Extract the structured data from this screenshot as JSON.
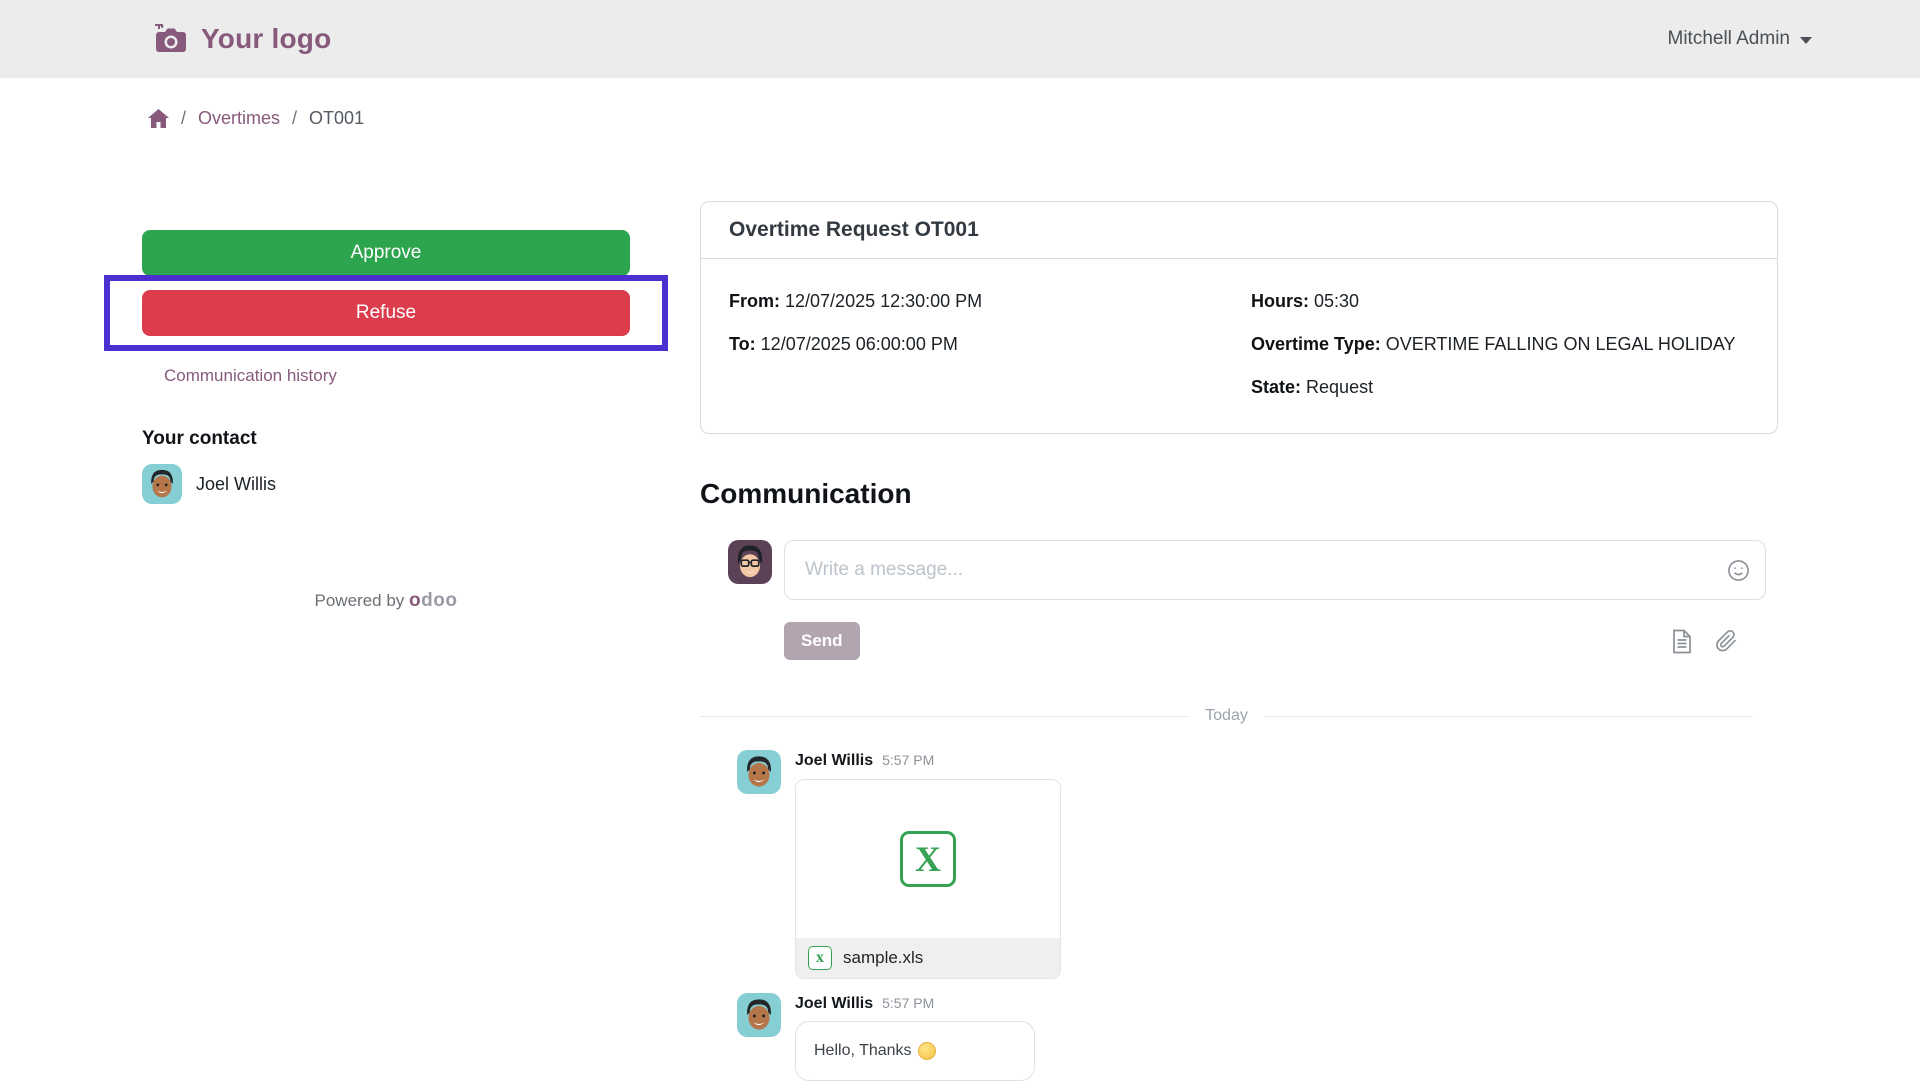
{
  "colors": {
    "brand_purple": "#875A7B",
    "approve_green": "#2DA44E",
    "refuse_red": "#DC3D4D",
    "annotation_purple": "#4B2FD1",
    "send_muted": "#B3A5AF",
    "excel_green": "#36A254",
    "header_bg": "#ECECEC"
  },
  "header": {
    "logo_text": "Your logo",
    "user_menu_label": "Mitchell Admin"
  },
  "breadcrumb": {
    "link": "Overtimes",
    "current": "OT001"
  },
  "sidebar": {
    "approve_label": "Approve",
    "refuse_label": "Refuse",
    "communication_history_label": "Communication history",
    "contact_heading": "Your contact",
    "contact_name": "Joel Willis",
    "powered_by_label": "Powered by",
    "odoo_first": "o",
    "odoo_rest": "doo"
  },
  "request_card": {
    "title": "Overtime Request OT001",
    "left_fields": [
      {
        "label": "From:",
        "value": "12/07/2025 12:30:00 PM"
      },
      {
        "label": "To:",
        "value": "12/07/2025 06:00:00 PM"
      }
    ],
    "right_fields": [
      {
        "label": "Hours:",
        "value": "05:30"
      },
      {
        "label": "Overtime Type:",
        "value": "OVERTIME FALLING ON LEGAL HOLIDAY"
      },
      {
        "label": "State:",
        "value": "Request"
      }
    ]
  },
  "communication": {
    "heading": "Communication",
    "composer": {
      "placeholder": "Write a message...",
      "send_label": "Send"
    },
    "divider_label": "Today",
    "messages": [
      {
        "author": "Joel Willis",
        "time": "5:57 PM",
        "attachment": {
          "filename": "sample.xls",
          "type_letter": "x",
          "type_letter_big": "X"
        }
      },
      {
        "author": "Joel Willis",
        "time": "5:57 PM",
        "partial_text": "Hello, Thanks"
      }
    ]
  }
}
